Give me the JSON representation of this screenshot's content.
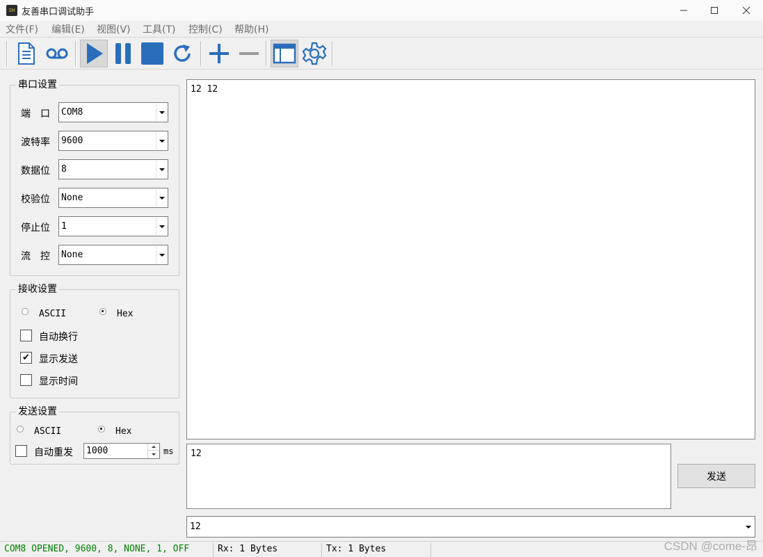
{
  "window": {
    "title": "友善串口调试助手",
    "app_icon_text": "SH",
    "controls": {
      "minimize": "—",
      "maximize": "☐",
      "close": "✕"
    }
  },
  "menu": [
    "文件(F)",
    "编辑(E)",
    "视图(V)",
    "工具(T)",
    "控制(C)",
    "帮助(H)"
  ],
  "toolbar": {
    "icons": [
      "document-icon",
      "cassette-icon",
      "play-icon",
      "pause-icon",
      "stop-icon",
      "refresh-icon",
      "plus-icon",
      "minus-icon",
      "window-icon",
      "gear-icon"
    ],
    "accent_color": "#2a6ebb",
    "disabled_color": "#9a9a9a"
  },
  "serial_settings": {
    "title": "串口设置",
    "fields": [
      {
        "label": "端　口",
        "value": "COM8"
      },
      {
        "label": "波特率",
        "value": "9600"
      },
      {
        "label": "数据位",
        "value": "8"
      },
      {
        "label": "校验位",
        "value": "None"
      },
      {
        "label": "停止位",
        "value": "1"
      },
      {
        "label": "流　控",
        "value": "None"
      }
    ]
  },
  "receive_settings": {
    "title": "接收设置",
    "mode_options": [
      {
        "label": "ASCII",
        "checked": false
      },
      {
        "label": "Hex",
        "checked": true
      }
    ],
    "checkboxes": [
      {
        "label": "自动换行",
        "checked": false
      },
      {
        "label": "显示发送",
        "checked": true
      },
      {
        "label": "显示时间",
        "checked": false
      }
    ]
  },
  "send_settings": {
    "title": "发送设置",
    "mode_options": [
      {
        "label": "ASCII",
        "checked": false
      },
      {
        "label": "Hex",
        "checked": true
      }
    ],
    "auto_resend": {
      "label": "自动重发",
      "checked": false,
      "interval": "1000",
      "unit": "ms"
    }
  },
  "receive_area": {
    "text": "12 12"
  },
  "send_area": {
    "text": "12"
  },
  "send_button": {
    "label": "发送"
  },
  "history_combo": {
    "value": "12"
  },
  "status_bar": {
    "connection": "COM8 OPENED, 9600, 8, NONE, 1, OFF",
    "connection_color": "#008000",
    "rx": "Rx: 1 Bytes",
    "tx": "Tx: 1 Bytes"
  },
  "watermark": "CSDN @come-昂"
}
